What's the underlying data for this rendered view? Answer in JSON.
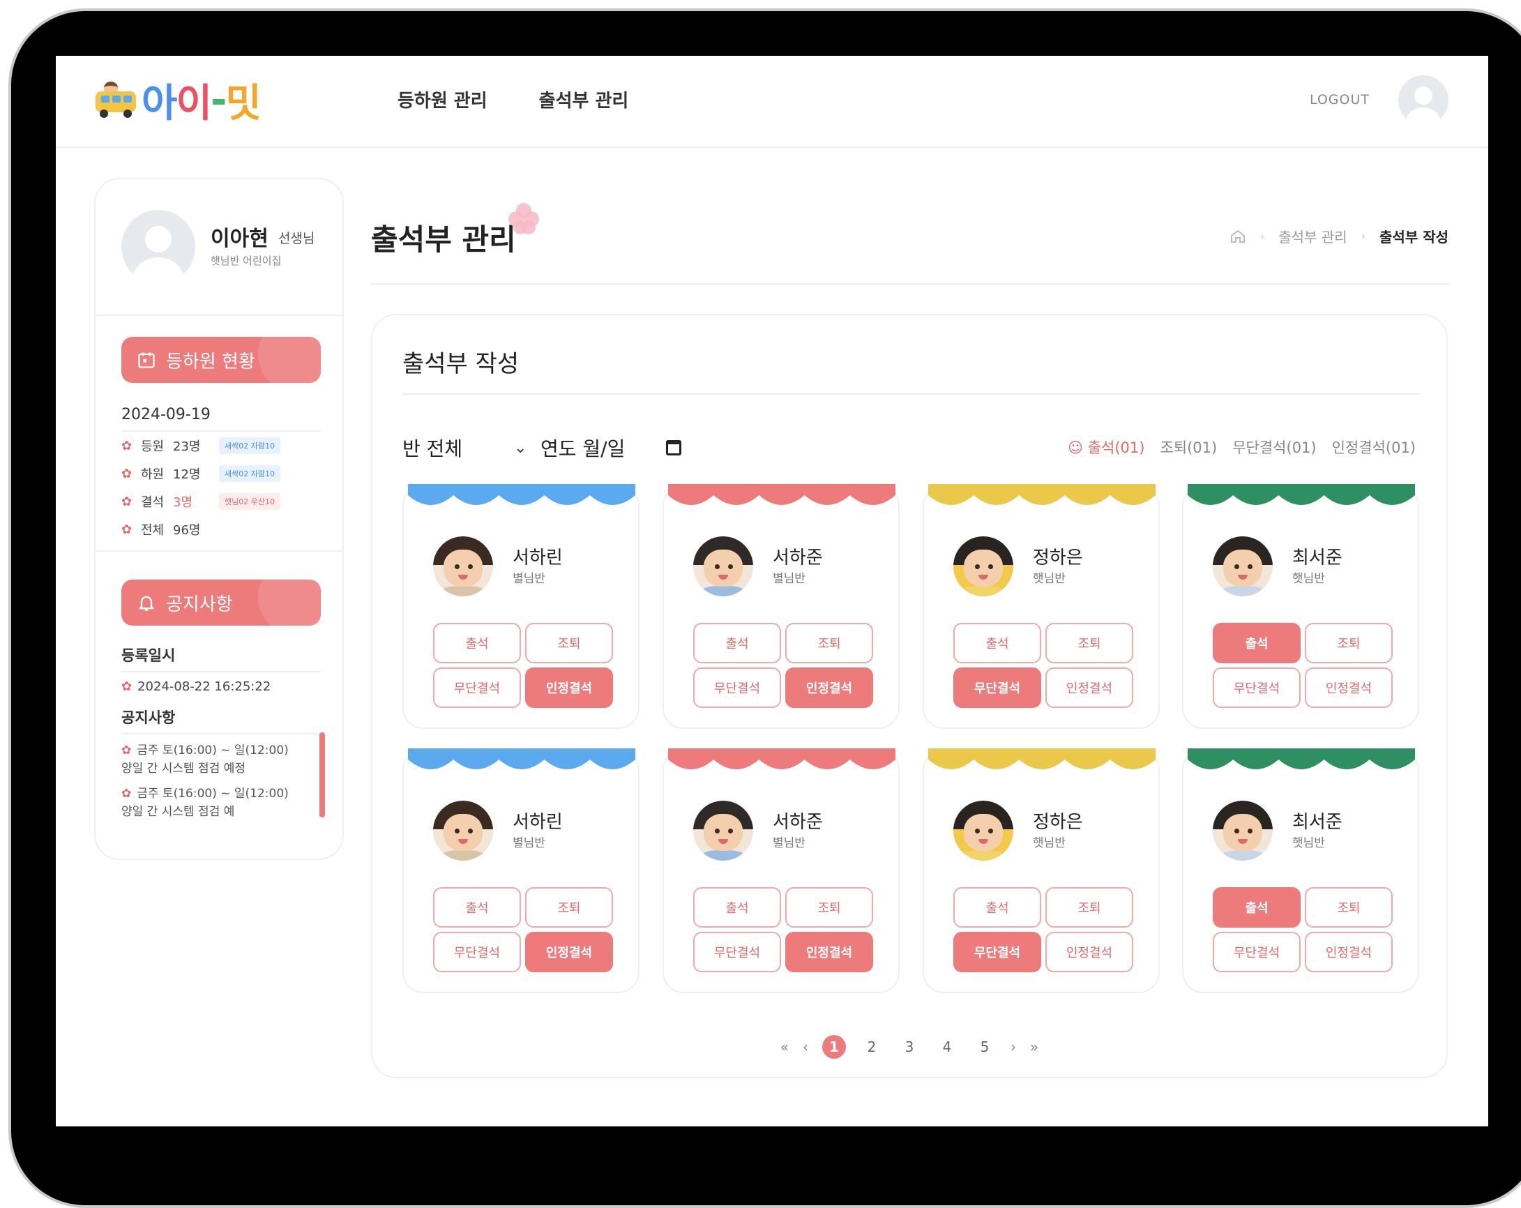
{
  "header": {
    "logo_text": "아이-밋",
    "nav": [
      "등하원 관리",
      "출석부 관리"
    ],
    "logout": "LOGOUT"
  },
  "profile": {
    "name": "이아현",
    "role": "선생님",
    "school": "햇님반 어린이집"
  },
  "status": {
    "button": "등하원 현황",
    "date": "2024-09-19",
    "rows": [
      {
        "label": "등원",
        "count": "23명",
        "badge": "새싹02 자람10",
        "badge_color": "blue"
      },
      {
        "label": "하원",
        "count": "12명",
        "badge": "새싹02 자람10",
        "badge_color": "blue"
      },
      {
        "label": "결석",
        "count": "3명",
        "badge": "햇님02 우산10",
        "badge_color": "red"
      },
      {
        "label": "전체",
        "count": "96명",
        "badge": "",
        "badge_color": ""
      }
    ]
  },
  "notice": {
    "button": "공지사항",
    "reg_heading": "등록일시",
    "reg_date": "2024-08-22 16:25:22",
    "notice_heading": "공지사항",
    "items": [
      "금주 토(16:00) ~ 일(12:00) 양일 간 시스템 점검 예정",
      "금주 토(16:00) ~ 일(12:00) 양일 간 시스템 점검 예"
    ]
  },
  "page": {
    "title": "출석부 관리",
    "breadcrumb": [
      "출석부 관리",
      "출석부 작성"
    ]
  },
  "panel": {
    "title": "출석부 작성",
    "class_select": "반 전체",
    "date_input": "연도 월/일",
    "legend": [
      "출석(01)",
      "조퇴(01)",
      "무단결석(01)",
      "인정결석(01)"
    ]
  },
  "attendance_labels": [
    "출석",
    "조퇴",
    "무단결석",
    "인정결석"
  ],
  "colors": {
    "accent": "#ee7b7b",
    "blue": "#5ba9ef",
    "red": "#ee7b7b",
    "yellow": "#e9c84a",
    "green": "#2e8f62"
  },
  "students": [
    {
      "name": "서하린",
      "class": "별님반",
      "color": "blue",
      "selected": "인정결석"
    },
    {
      "name": "서하준",
      "class": "별님반",
      "color": "red",
      "selected": "인정결석"
    },
    {
      "name": "정하은",
      "class": "햇님반",
      "color": "yellow",
      "selected": "무단결석"
    },
    {
      "name": "최서준",
      "class": "햇님반",
      "color": "green",
      "selected": "출석"
    },
    {
      "name": "서하린",
      "class": "별님반",
      "color": "blue",
      "selected": "인정결석"
    },
    {
      "name": "서하준",
      "class": "별님반",
      "color": "red",
      "selected": "인정결석"
    },
    {
      "name": "정하은",
      "class": "햇님반",
      "color": "yellow",
      "selected": "무단결석"
    },
    {
      "name": "최서준",
      "class": "햇님반",
      "color": "green",
      "selected": "출석"
    }
  ],
  "pagination": {
    "first": "«",
    "prev": "‹",
    "pages": [
      "1",
      "2",
      "3",
      "4",
      "5"
    ],
    "current": "1",
    "next": "›",
    "last": "»"
  }
}
